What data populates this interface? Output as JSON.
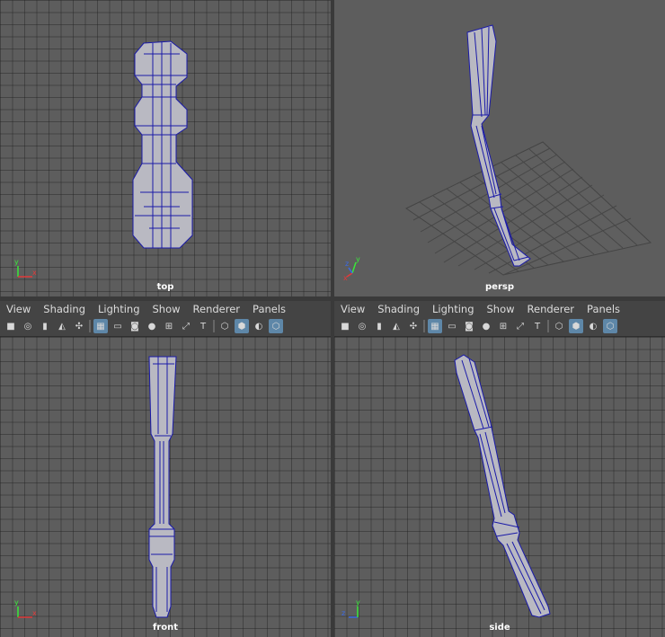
{
  "panels": {
    "top": {
      "label": "top",
      "axis": {
        "v": "y",
        "h": "x"
      }
    },
    "persp": {
      "label": "persp",
      "axis": {
        "v": "y",
        "h": "x",
        "z": "z"
      }
    },
    "front": {
      "label": "front",
      "axis": {
        "v": "y",
        "h": "x"
      }
    },
    "side": {
      "label": "side",
      "axis": {
        "v": "y",
        "h": "z"
      }
    }
  },
  "menu": {
    "view": "View",
    "shading": "Shading",
    "lighting": "Lighting",
    "show": "Show",
    "renderer": "Renderer",
    "panels": "Panels"
  },
  "toolbar_icons": [
    "camera-icon",
    "camera-attrs-icon",
    "bookmark-icon",
    "image-plane-icon",
    "2d-pan-zoom-icon",
    "grid-icon",
    "film-gate-icon",
    "resolution-gate-icon",
    "gate-mask-icon",
    "field-chart-icon",
    "safe-action-icon",
    "safe-title-icon",
    "wireframe-icon",
    "smooth-shade-icon",
    "wireframe-on-shaded-icon",
    "xray-icon"
  ],
  "colors": {
    "viewport_bg": "#5d5d5d",
    "grid": "#3a3a3a",
    "wire": "#1a1aa8",
    "mesh": "#b9b9c2",
    "toggle_on": "#5e87a8"
  }
}
